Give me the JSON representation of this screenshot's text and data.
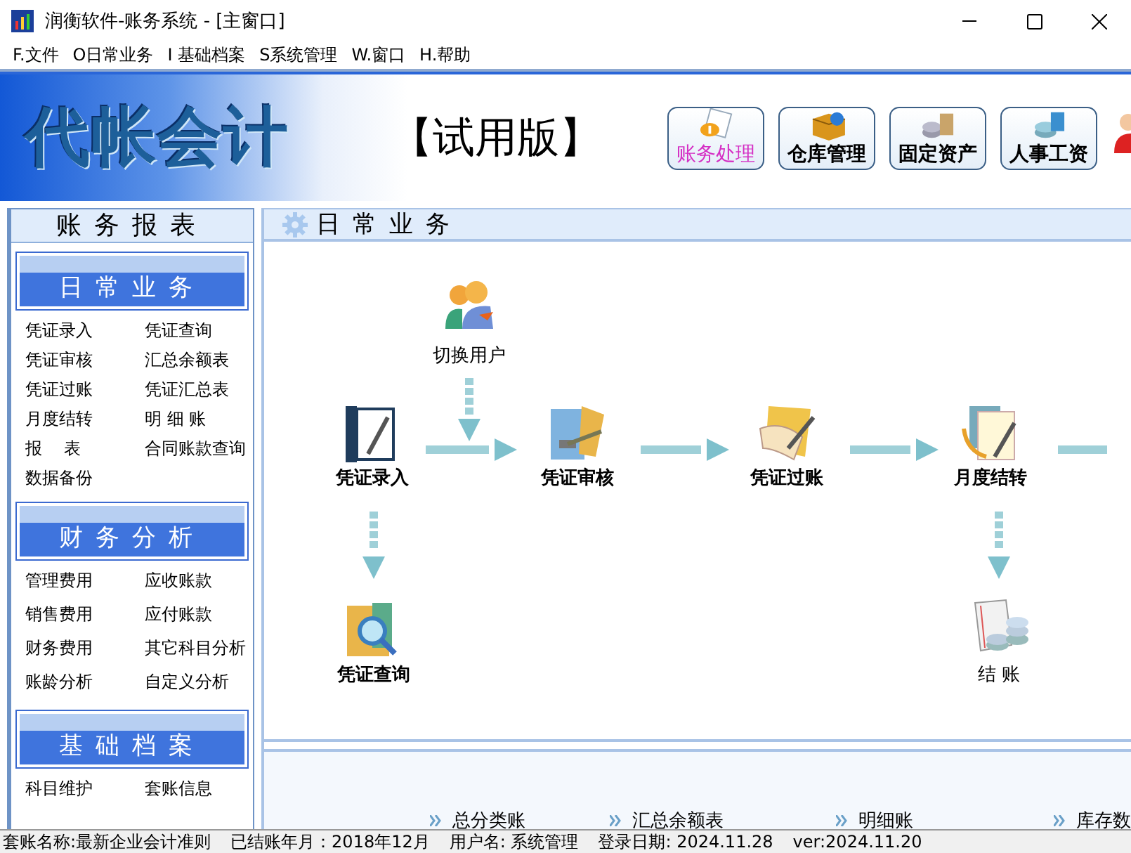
{
  "window": {
    "title": "润衡软件-账务系统 - [主窗口]"
  },
  "menu": [
    "F.文件",
    "O日常业务",
    "I 基础档案",
    "S系统管理",
    "W.窗口",
    "H.帮助"
  ],
  "header": {
    "logo": "代帐会计",
    "edition": "【试用版】",
    "modules": [
      {
        "label": "账务处理",
        "kind": "ledger",
        "selected": true
      },
      {
        "label": "仓库管理",
        "kind": "warehouse",
        "selected": false
      },
      {
        "label": "固定资产",
        "kind": "assets",
        "selected": false
      },
      {
        "label": "人事工资",
        "kind": "payroll",
        "selected": false
      }
    ]
  },
  "sidebar": {
    "title": "账务报表",
    "sections": [
      {
        "title": "日常业务",
        "items": [
          "凭证录入",
          "凭证查询",
          "凭证审核",
          "汇总余额表",
          "凭证过账",
          "凭证汇总表",
          "月度结转",
          "明 细 账",
          "报    表",
          "合同账款查询",
          "数据备份"
        ]
      },
      {
        "title": "财务分析",
        "items": [
          "管理费用",
          "应收账款",
          "销售费用",
          "应付账款",
          "财务费用",
          "其它科目分析",
          "账龄分析",
          "自定义分析"
        ]
      },
      {
        "title": "基础档案",
        "items": [
          "科目维护",
          "套账信息"
        ]
      }
    ]
  },
  "main": {
    "title": "日常业务",
    "nodes": [
      {
        "label": "切换用户",
        "kind": "users"
      },
      {
        "label": "凭证录入",
        "kind": "entry"
      },
      {
        "label": "凭证审核",
        "kind": "audit"
      },
      {
        "label": "凭证过账",
        "kind": "posting"
      },
      {
        "label": "月度结转",
        "kind": "carry"
      },
      {
        "label": "凭证查询",
        "kind": "query"
      },
      {
        "label": "结 账",
        "kind": "close"
      }
    ],
    "quick_links": [
      "总分类账",
      "汇总余额表",
      "明细账",
      "库存数"
    ]
  },
  "status_bar": [
    "套账名称:最新企业会计准则",
    "已结账年月：2018年12月",
    "用户名: 系统管理",
    "登录日期: 2024.11.28",
    "ver:2024.11.20"
  ]
}
